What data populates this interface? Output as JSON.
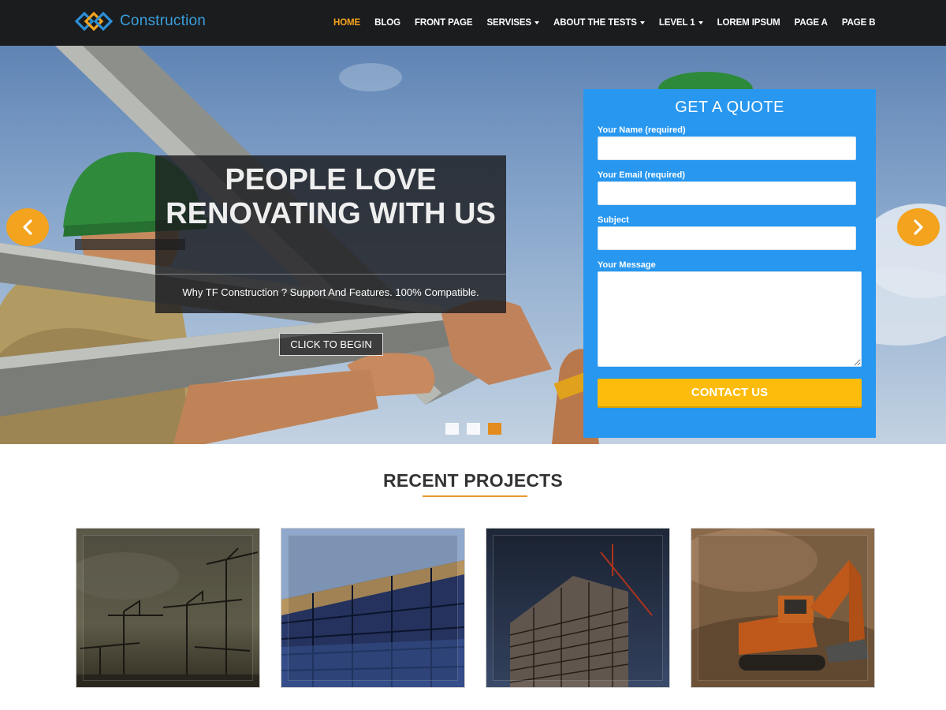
{
  "site": {
    "logo_text": "Construction",
    "logo_icon": "interlocking-diamonds-logo",
    "accent_color": "#f7a51a"
  },
  "nav": {
    "items": [
      {
        "label": "HOME",
        "active": true,
        "has_dropdown": false
      },
      {
        "label": "BLOG",
        "active": false,
        "has_dropdown": false
      },
      {
        "label": "FRONT PAGE",
        "active": false,
        "has_dropdown": false
      },
      {
        "label": "SERVISES",
        "active": false,
        "has_dropdown": true
      },
      {
        "label": "ABOUT THE TESTS",
        "active": false,
        "has_dropdown": true
      },
      {
        "label": "LEVEL 1",
        "active": false,
        "has_dropdown": true
      },
      {
        "label": "LOREM IPSUM",
        "active": false,
        "has_dropdown": false
      },
      {
        "label": "PAGE A",
        "active": false,
        "has_dropdown": false
      },
      {
        "label": "PAGE B",
        "active": false,
        "has_dropdown": false
      }
    ]
  },
  "hero": {
    "title": "PEOPLE LOVE RENOVATING WITH US",
    "subtitle": "Why TF Construction ? Support And Features. 100% Compatible.",
    "button_label": "CLICK TO BEGIN",
    "prev_icon": "chevron-left-icon",
    "next_icon": "chevron-right-icon",
    "slides_count": 3,
    "active_slide": 3
  },
  "quote_form": {
    "title": "GET A QUOTE",
    "fields": {
      "name_label": "Your Name (required)",
      "email_label": "Your Email (required)",
      "subject_label": "Subject",
      "message_label": "Your Message"
    },
    "values": {
      "name": "",
      "email": "",
      "subject": "",
      "message": ""
    },
    "submit_label": "CONTACT US",
    "background_color": "#2897ef",
    "submit_color": "#fdbc0b"
  },
  "projects": {
    "title": "RECENT PROJECTS",
    "items": [
      {
        "subject": "cranes-at-dusk"
      },
      {
        "subject": "glass-skyscraper"
      },
      {
        "subject": "building-under-construction"
      },
      {
        "subject": "excavator"
      }
    ]
  }
}
